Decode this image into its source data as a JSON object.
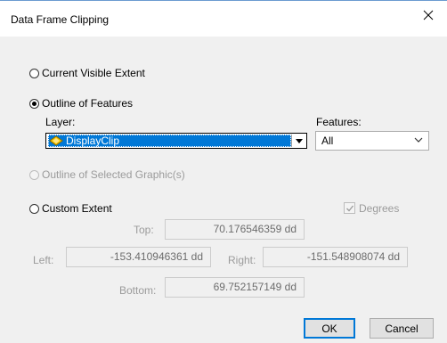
{
  "window": {
    "title": "Data Frame Clipping"
  },
  "options": {
    "current_visible_extent": "Current Visible Extent",
    "outline_of_features": "Outline of Features",
    "outline_of_selected_graphics": "Outline of Selected Graphic(s)",
    "custom_extent": "Custom Extent",
    "selected": "outline_of_features"
  },
  "layer": {
    "label": "Layer:",
    "value": "DisplayClip"
  },
  "features": {
    "label": "Features:",
    "value": "All"
  },
  "degrees": {
    "label": "Degrees",
    "checked": true
  },
  "extent": {
    "top_label": "Top:",
    "top_value": "70.176546359 dd",
    "left_label": "Left:",
    "left_value": "-153.410946361 dd",
    "right_label": "Right:",
    "right_value": "-151.548908074 dd",
    "bottom_label": "Bottom:",
    "bottom_value": "69.752157149 dd"
  },
  "buttons": {
    "ok": "OK",
    "cancel": "Cancel"
  },
  "colors": {
    "accent": "#0078d7",
    "dialog_bg": "#f0f0f0",
    "disabled_text": "#9b9b9b"
  }
}
